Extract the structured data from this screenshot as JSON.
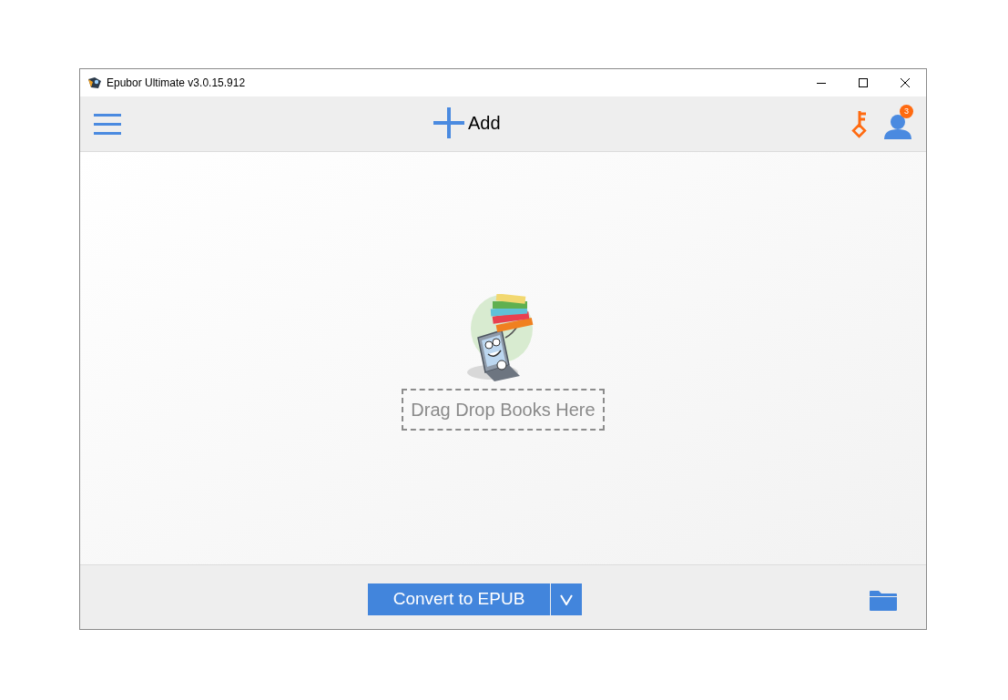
{
  "window": {
    "title": "Epubor Ultimate v3.0.15.912"
  },
  "toolbar": {
    "add_label": "Add",
    "notification_count": "3"
  },
  "drop_zone": {
    "label": "Drag Drop Books Here"
  },
  "footer": {
    "convert_button": "Convert to EPUB"
  }
}
